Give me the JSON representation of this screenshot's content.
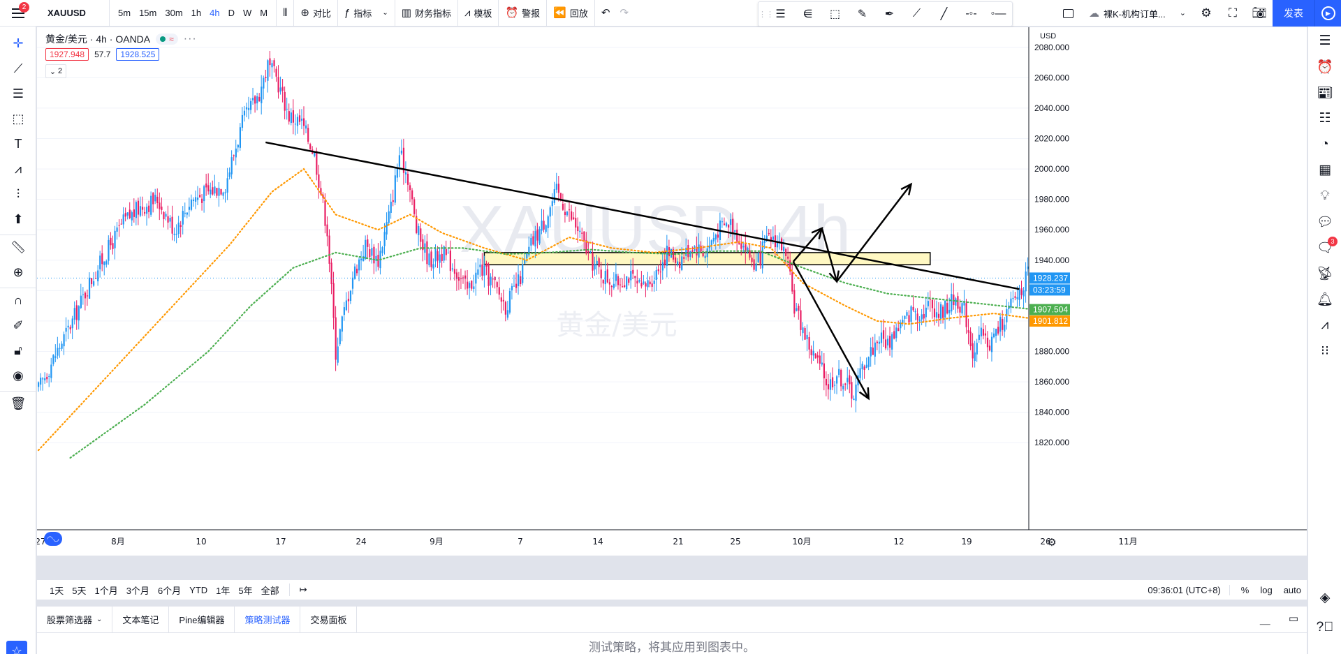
{
  "topbar": {
    "menu_badge": "2",
    "symbol": "XAUUSD",
    "intervals": [
      "5m",
      "15m",
      "30m",
      "1h",
      "4h",
      "D",
      "W",
      "M"
    ],
    "active_interval": "4h",
    "compare_label": "对比",
    "indicators_label": "指标",
    "financials_label": "财务指标",
    "templates_label": "模板",
    "alert_label": "警报",
    "replay_label": "回放",
    "template_name": "裸K-机构订单...",
    "publish_label": "发表"
  },
  "legend": {
    "title": "黄金/美元 · 4h · OANDA",
    "bid": "1927.948",
    "spread": "57.7",
    "ask": "1928.525",
    "collapse_count": "2"
  },
  "watermark": {
    "line1": "XAUUSD, 4h",
    "line2": "黄金/美元"
  },
  "price_axis": {
    "currency": "USD",
    "ticks": [
      "2080.000",
      "2060.000",
      "2040.000",
      "2020.000",
      "2000.000",
      "1980.000",
      "1960.000",
      "1940.000",
      "1920.000",
      "1900.000",
      "1880.000",
      "1860.000",
      "1840.000",
      "1820.000"
    ],
    "last_price": "1928.237",
    "countdown": "03:23:59",
    "ma_green": "1907.504",
    "ma_orange": "1901.812",
    "colors": {
      "last": "#2196f3",
      "green": "#4caf50",
      "orange": "#ff9800"
    }
  },
  "time_axis": {
    "labels": [
      "27",
      "8月",
      "10",
      "17",
      "24",
      "9月",
      "7",
      "14",
      "21",
      "25",
      "10月",
      "12",
      "19",
      "26",
      "11月"
    ]
  },
  "rangebar": {
    "ranges": [
      "1天",
      "5天",
      "1个月",
      "3个月",
      "6个月",
      "YTD",
      "1年",
      "5年",
      "全部"
    ],
    "clock": "09:36:01 (UTC+8)",
    "options": [
      "%",
      "log",
      "auto"
    ]
  },
  "bottom": {
    "tabs": [
      "股票筛选器",
      "文本笔记",
      "Pine编辑器",
      "策略测试器",
      "交易面板"
    ],
    "active_tab": "策略测试器",
    "message": "测试策略，将其应用到图表中。"
  },
  "rightbar": {
    "ideas_badge": "3"
  },
  "chart_data": {
    "type": "candlestick",
    "symbol": "XAUUSD",
    "timeframe": "4h",
    "ylim": [
      1810,
      2090
    ],
    "close_path": [
      [
        0,
        1855
      ],
      [
        8,
        1878
      ],
      [
        16,
        1900
      ],
      [
        24,
        1925
      ],
      [
        32,
        1945
      ],
      [
        40,
        1965
      ],
      [
        48,
        1975
      ],
      [
        56,
        1980
      ],
      [
        64,
        1960
      ],
      [
        72,
        1980
      ],
      [
        80,
        1985
      ],
      [
        88,
        1990
      ],
      [
        96,
        2030
      ],
      [
        104,
        2050
      ],
      [
        108,
        2068
      ],
      [
        112,
        2060
      ],
      [
        118,
        2035
      ],
      [
        124,
        2030
      ],
      [
        130,
        2010
      ],
      [
        136,
        1960
      ],
      [
        140,
        1880
      ],
      [
        143,
        1900
      ],
      [
        148,
        1930
      ],
      [
        154,
        1950
      ],
      [
        160,
        1940
      ],
      [
        166,
        1975
      ],
      [
        170,
        2010
      ],
      [
        174,
        1995
      ],
      [
        178,
        1960
      ],
      [
        184,
        1940
      ],
      [
        190,
        1945
      ],
      [
        196,
        1935
      ],
      [
        202,
        1920
      ],
      [
        208,
        1935
      ],
      [
        214,
        1925
      ],
      [
        220,
        1910
      ],
      [
        226,
        1925
      ],
      [
        232,
        1950
      ],
      [
        238,
        1965
      ],
      [
        244,
        1985
      ],
      [
        248,
        1975
      ],
      [
        254,
        1960
      ],
      [
        260,
        1940
      ],
      [
        266,
        1930
      ],
      [
        272,
        1925
      ],
      [
        278,
        1930
      ],
      [
        284,
        1920
      ],
      [
        290,
        1930
      ],
      [
        296,
        1945
      ],
      [
        302,
        1940
      ],
      [
        308,
        1950
      ],
      [
        314,
        1945
      ],
      [
        320,
        1960
      ],
      [
        326,
        1965
      ],
      [
        330,
        1955
      ],
      [
        334,
        1945
      ],
      [
        338,
        1935
      ],
      [
        342,
        1950
      ],
      [
        346,
        1955
      ],
      [
        350,
        1950
      ],
      [
        353,
        1935
      ],
      [
        356,
        1910
      ],
      [
        360,
        1895
      ],
      [
        364,
        1880
      ],
      [
        368,
        1870
      ],
      [
        372,
        1858
      ],
      [
        376,
        1865
      ],
      [
        380,
        1860
      ],
      [
        384,
        1852
      ],
      [
        388,
        1870
      ],
      [
        392,
        1880
      ],
      [
        396,
        1890
      ],
      [
        400,
        1885
      ],
      [
        404,
        1895
      ],
      [
        408,
        1900
      ],
      [
        412,
        1908
      ],
      [
        416,
        1905
      ],
      [
        420,
        1912
      ],
      [
        424,
        1905
      ],
      [
        428,
        1910
      ],
      [
        432,
        1915
      ],
      [
        436,
        1908
      ],
      [
        440,
        1880
      ],
      [
        444,
        1890
      ],
      [
        448,
        1885
      ],
      [
        452,
        1895
      ],
      [
        456,
        1905
      ],
      [
        460,
        1915
      ],
      [
        464,
        1925
      ],
      [
        466,
        1930
      ]
    ],
    "ma_orange": [
      [
        0,
        1815
      ],
      [
        30,
        1860
      ],
      [
        60,
        1905
      ],
      [
        90,
        1950
      ],
      [
        110,
        1985
      ],
      [
        125,
        2000
      ],
      [
        140,
        1970
      ],
      [
        160,
        1960
      ],
      [
        175,
        1970
      ],
      [
        190,
        1958
      ],
      [
        210,
        1948
      ],
      [
        230,
        1940
      ],
      [
        250,
        1955
      ],
      [
        270,
        1948
      ],
      [
        290,
        1945
      ],
      [
        310,
        1948
      ],
      [
        330,
        1952
      ],
      [
        345,
        1948
      ],
      [
        360,
        1925
      ],
      [
        380,
        1910
      ],
      [
        395,
        1900
      ],
      [
        410,
        1898
      ],
      [
        430,
        1902
      ],
      [
        450,
        1905
      ],
      [
        466,
        1902
      ]
    ],
    "ma_green": [
      [
        15,
        1810
      ],
      [
        50,
        1845
      ],
      [
        80,
        1880
      ],
      [
        100,
        1910
      ],
      [
        120,
        1935
      ],
      [
        140,
        1945
      ],
      [
        160,
        1940
      ],
      [
        180,
        1948
      ],
      [
        200,
        1948
      ],
      [
        220,
        1944
      ],
      [
        240,
        1945
      ],
      [
        260,
        1947
      ],
      [
        280,
        1945
      ],
      [
        300,
        1944
      ],
      [
        320,
        1946
      ],
      [
        340,
        1946
      ],
      [
        360,
        1935
      ],
      [
        380,
        1925
      ],
      [
        400,
        1918
      ],
      [
        420,
        1915
      ],
      [
        440,
        1912
      ],
      [
        466,
        1908
      ]
    ],
    "annotations": {
      "trendline": {
        "from": [
          107,
          2017.5
        ],
        "to": [
          462,
          1921
        ]
      },
      "zone": {
        "from_price": 1937,
        "to_price": 1945,
        "x_start": 210,
        "x_end": 420
      }
    }
  }
}
